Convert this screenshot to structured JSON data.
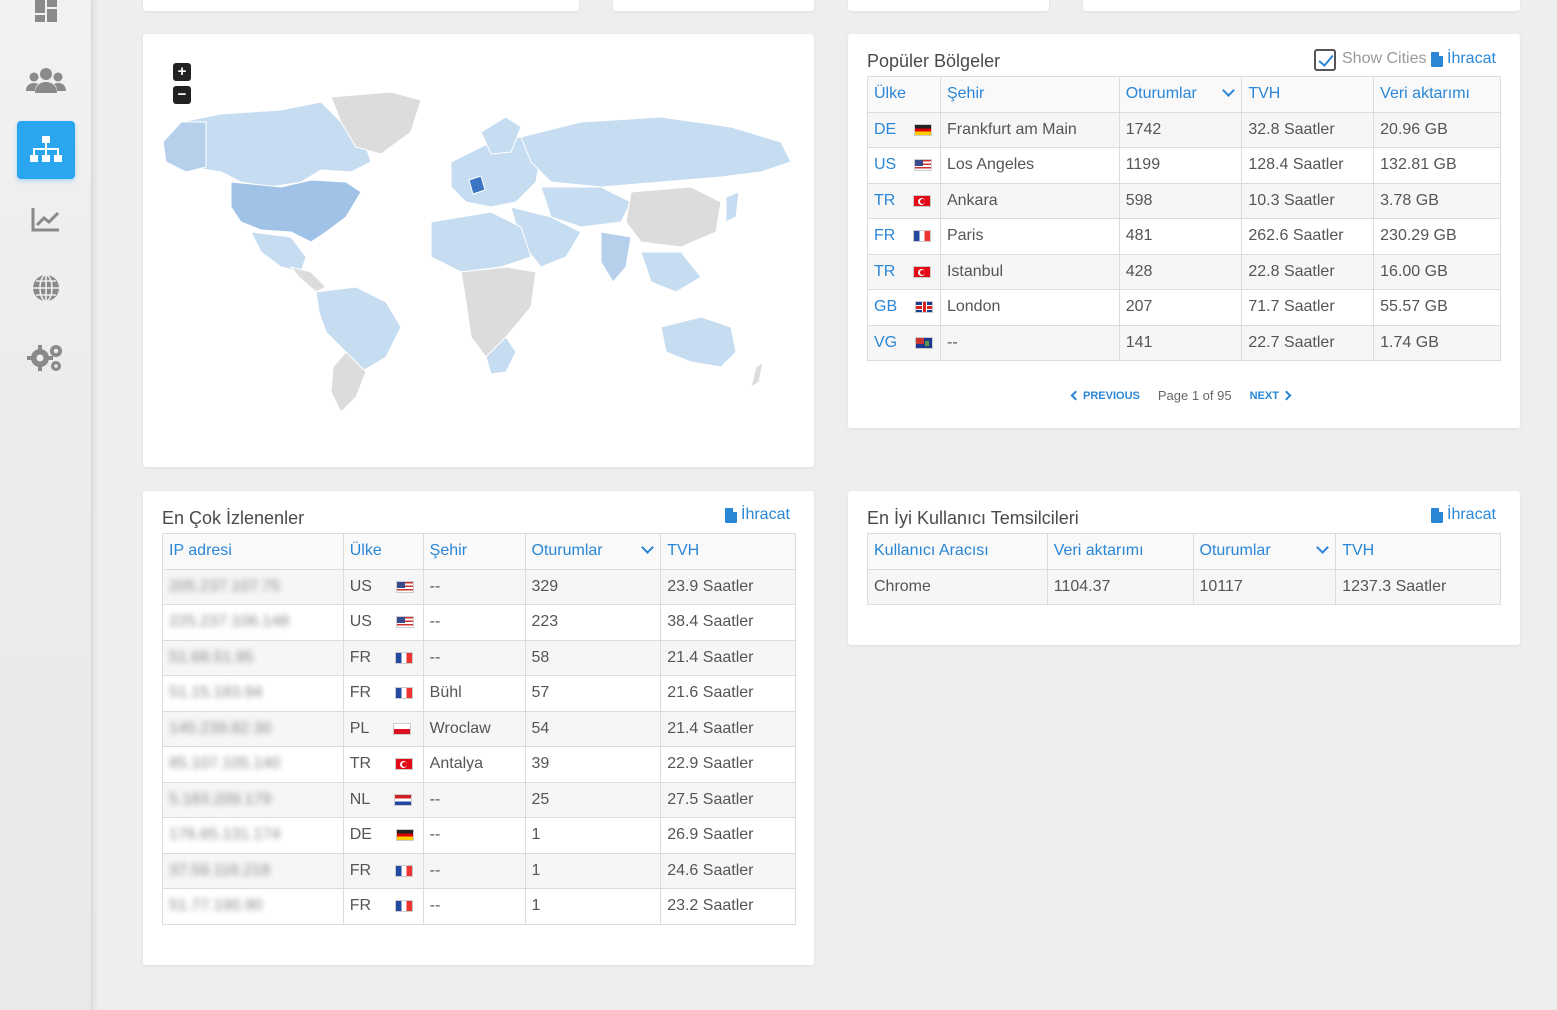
{
  "sidebar": {
    "items": [
      {
        "icon": "dashboard-icon",
        "active": false
      },
      {
        "icon": "users-icon",
        "active": false
      },
      {
        "icon": "sitemap-icon",
        "active": true
      },
      {
        "icon": "chart-line-icon",
        "active": false
      },
      {
        "icon": "globe-icon",
        "active": false
      },
      {
        "icon": "gears-icon",
        "active": false
      }
    ]
  },
  "map": {
    "zoom_in": "+",
    "zoom_out": "−"
  },
  "popular_regions": {
    "title": "Popüler Bölgeler",
    "show_cities_label": "Show Cities",
    "show_cities_checked": true,
    "export_label": "İhracat",
    "columns": [
      "Ülke",
      "Şehir",
      "Oturumlar",
      "TVH",
      "Veri aktarımı"
    ],
    "rows": [
      {
        "code": "DE",
        "flag": "de",
        "city": "Frankfurt am Main",
        "sessions": "1742",
        "tvh": "32.8 Saatler",
        "transfer": "20.96 GB"
      },
      {
        "code": "US",
        "flag": "us",
        "city": "Los Angeles",
        "sessions": "1199",
        "tvh": "128.4 Saatler",
        "transfer": "132.81 GB"
      },
      {
        "code": "TR",
        "flag": "tr",
        "city": "Ankara",
        "sessions": "598",
        "tvh": "10.3 Saatler",
        "transfer": "3.78 GB"
      },
      {
        "code": "FR",
        "flag": "fr",
        "city": "Paris",
        "sessions": "481",
        "tvh": "262.6 Saatler",
        "transfer": "230.29 GB"
      },
      {
        "code": "TR",
        "flag": "tr",
        "city": "Istanbul",
        "sessions": "428",
        "tvh": "22.8 Saatler",
        "transfer": "16.00 GB"
      },
      {
        "code": "GB",
        "flag": "gb",
        "city": "London",
        "sessions": "207",
        "tvh": "71.7 Saatler",
        "transfer": "55.57 GB"
      },
      {
        "code": "VG",
        "flag": "vg",
        "city": "--",
        "sessions": "141",
        "tvh": "22.7 Saatler",
        "transfer": "1.74 GB"
      }
    ],
    "pager": {
      "previous": "PREVIOUS",
      "info": "Page 1 of 95",
      "next": "NEXT"
    }
  },
  "most_viewed": {
    "title": "En Çok İzlenenler",
    "export_label": "İhracat",
    "columns": [
      "IP adresi",
      "Ülke",
      "Şehir",
      "Oturumlar",
      "TVH"
    ],
    "rows": [
      {
        "ip": "205.237.107.75",
        "country": "US",
        "flag": "us",
        "city": "--",
        "sessions": "329",
        "tvh": "23.9 Saatler"
      },
      {
        "ip": "225.237.106.148",
        "country": "US",
        "flag": "us",
        "city": "--",
        "sessions": "223",
        "tvh": "38.4 Saatler"
      },
      {
        "ip": "51.68.51.95",
        "country": "FR",
        "flag": "fr",
        "city": "--",
        "sessions": "58",
        "tvh": "21.4 Saatler"
      },
      {
        "ip": "51.15.183.94",
        "country": "FR",
        "flag": "fr",
        "city": "Bühl",
        "sessions": "57",
        "tvh": "21.6 Saatler"
      },
      {
        "ip": "145.239.82.30",
        "country": "PL",
        "flag": "pl",
        "city": "Wroclaw",
        "sessions": "54",
        "tvh": "21.4 Saatler"
      },
      {
        "ip": "85.107.105.140",
        "country": "TR",
        "flag": "tr",
        "city": "Antalya",
        "sessions": "39",
        "tvh": "22.9 Saatler"
      },
      {
        "ip": "5.183.209.179",
        "country": "NL",
        "flag": "nl",
        "city": "--",
        "sessions": "25",
        "tvh": "27.5 Saatler"
      },
      {
        "ip": "176.65.131.174",
        "country": "DE",
        "flag": "de",
        "city": "--",
        "sessions": "1",
        "tvh": "26.9 Saatler"
      },
      {
        "ip": "37.59.116.218",
        "country": "FR",
        "flag": "fr",
        "city": "--",
        "sessions": "1",
        "tvh": "24.6 Saatler"
      },
      {
        "ip": "51.77.190.90",
        "country": "FR",
        "flag": "fr",
        "city": "--",
        "sessions": "1",
        "tvh": "23.2 Saatler"
      }
    ]
  },
  "top_agents": {
    "title": "En İyi Kullanıcı Temsilcileri",
    "export_label": "İhracat",
    "columns": [
      "Kullanıcı Aracısı",
      "Veri aktarımı",
      "Oturumlar",
      "TVH"
    ],
    "rows": [
      {
        "agent": "Chrome",
        "transfer": "1104.37",
        "sessions": "10117",
        "tvh": "1237.3 Saatler"
      }
    ]
  },
  "colors": {
    "accent": "#2a86d6",
    "active_sidebar": "#2aa6f0",
    "map_land": "#c6dcf0",
    "map_highlight": "#9fc2e6",
    "map_no_data": "#dcdcdc"
  }
}
